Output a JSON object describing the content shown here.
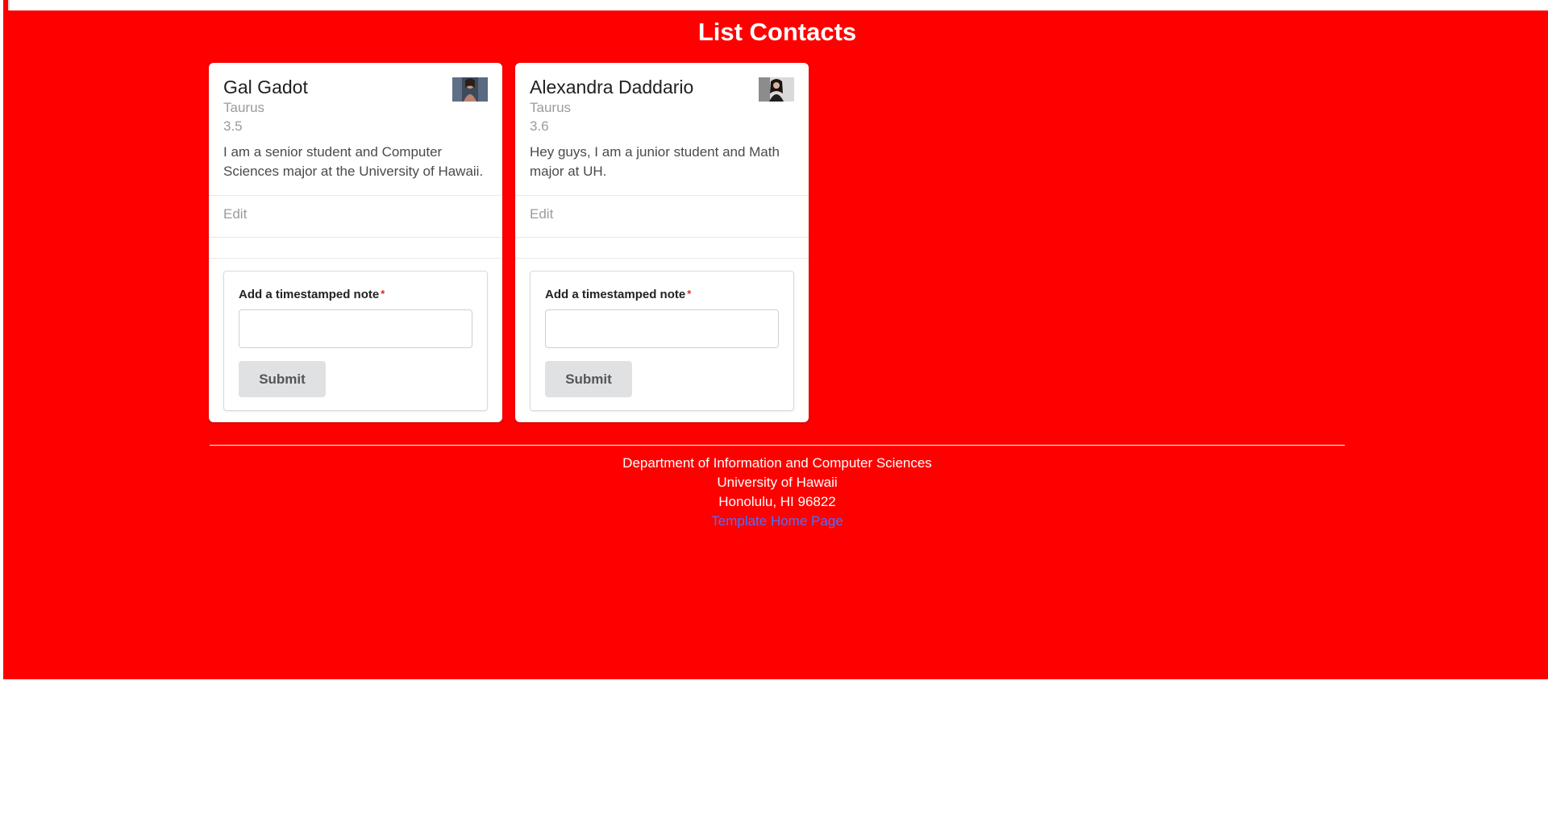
{
  "page": {
    "title": "List Contacts"
  },
  "colors": {
    "background": "#ff0000",
    "card": "#ffffff",
    "link": "#4a72ff",
    "button": "#e0e1e2"
  },
  "contacts": [
    {
      "name": "Gal Gadot",
      "sign": "Taurus",
      "gpa": "3.5",
      "description": "I am a senior student and Computer Sciences major at the University of Hawaii.",
      "edit_label": "Edit",
      "note_label": "Add a timestamped note",
      "required_mark": "*",
      "note_value": "",
      "submit_label": "Submit",
      "avatar_icon": "avatar-photo"
    },
    {
      "name": "Alexandra Daddario",
      "sign": "Taurus",
      "gpa": "3.6",
      "description": "Hey guys, I am a junior student and Math major at UH.",
      "edit_label": "Edit",
      "note_label": "Add a timestamped note",
      "required_mark": "*",
      "note_value": "",
      "submit_label": "Submit",
      "avatar_icon": "avatar-photo"
    }
  ],
  "footer": {
    "line1": "Department of Information and Computer Sciences",
    "line2": "University of Hawaii",
    "line3": "Honolulu, HI 96822",
    "link_label": "Template Home Page"
  }
}
